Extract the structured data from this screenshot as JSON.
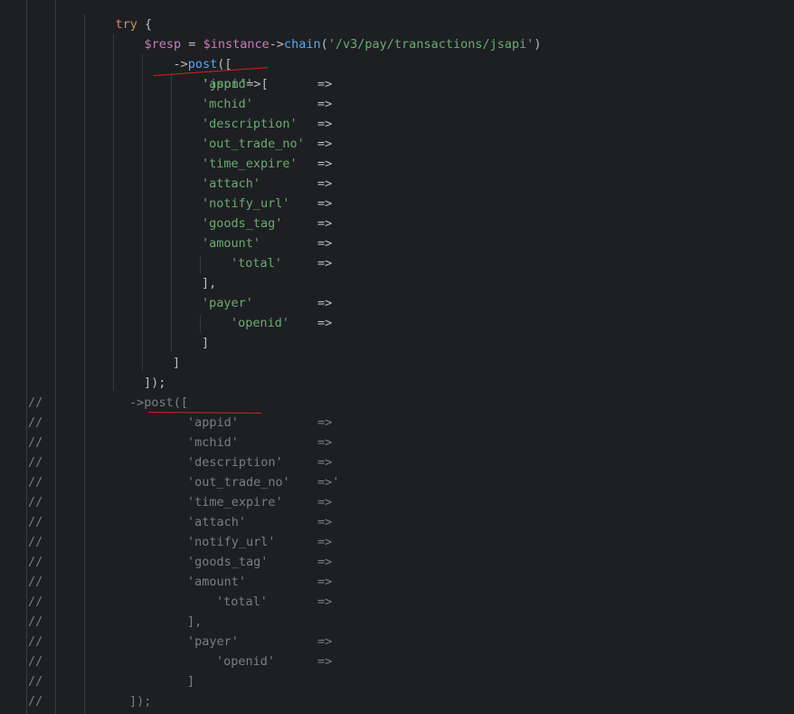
{
  "code": {
    "try_keyword": "try",
    "brace_open": "{",
    "resp_var": "$resp",
    "assign_op": "=",
    "instance_var": "$instance",
    "arrow": "->",
    "chain_fn": "chain",
    "paren_open": "(",
    "chain_arg": "'/v3/pay/transactions/jsapi'",
    "paren_close": ")",
    "post_fn": "post",
    "post_open": "([",
    "json_key": "'json'",
    "json_arrow": "=>",
    "bracket_open": "[",
    "double_arrow": "=>",
    "keys": {
      "appid": "'appid'",
      "mchid": "'mchid'",
      "description": "'description'",
      "out_trade_no": "'out_trade_no'",
      "time_expire": "'time_expire'",
      "attach": "'attach'",
      "notify_url": "'notify_url'",
      "goods_tag": "'goods_tag'",
      "amount": "'amount'",
      "total": "'total'",
      "payer": "'payer'",
      "openid": "'openid'"
    },
    "close_bracket_comma": "],",
    "close_bracket": "]",
    "close_post": "]);"
  },
  "commented": {
    "prefix": "//",
    "post_call": "->post([",
    "appid": "'appid'",
    "mchid": "'mchid'",
    "description": "'description'",
    "out_trade_no": "'out_trade_no'",
    "time_expire": "'time_expire'",
    "attach": "'attach'",
    "notify_url": "'notify_url'",
    "goods_tag": "'goods_tag'",
    "amount": "'amount'",
    "total": "'total'",
    "payer": "'payer'",
    "openid": "'openid'",
    "arrow": "=>",
    "arrow_quote": "=>'",
    "close_bracket_comma": "],",
    "close_bracket": "]",
    "close_post": "]);"
  },
  "colors": {
    "background": "#1e1f22",
    "keyword": "#cf8e6d",
    "variable": "#c77dbb",
    "function": "#56a8f5",
    "string": "#6aab73",
    "operator": "#bcbec4",
    "comment": "#7a7e85",
    "annotation_underline": "#d42424"
  }
}
